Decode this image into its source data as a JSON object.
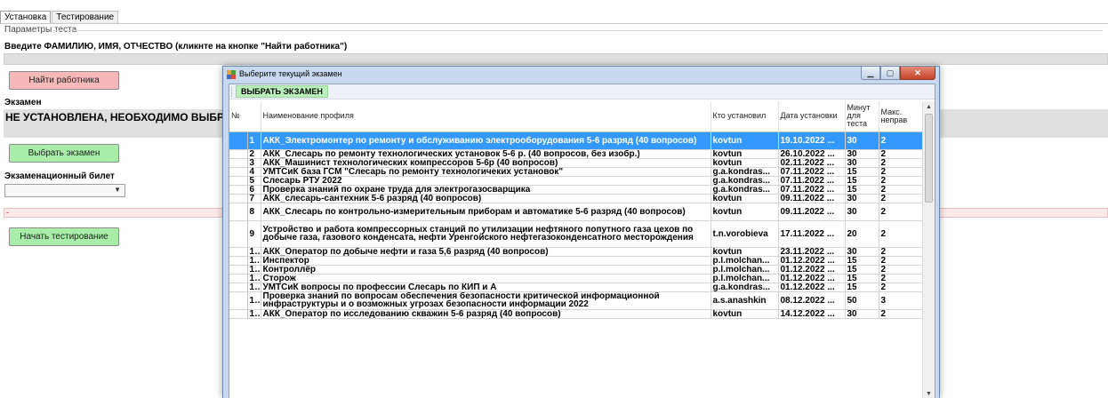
{
  "tabs": [
    {
      "label": "Установка"
    },
    {
      "label": "Тестирование"
    }
  ],
  "params_label": "Параметры теста",
  "prompt": "Введите ФАМИЛИЮ, ИМЯ, ОТЧЕСТВО (кликнте на кнопке \"Найти работника\")",
  "find_button": "Найти работника",
  "exam_label": "Экзамен",
  "exam_status": "НЕ УСТАНОВЛЕНА, НЕОБХОДИМО ВЫБРАТ",
  "choose_exam_button": "Выбрать экзамен",
  "ticket_label": "Экзаменационный билет",
  "ticket_value": "",
  "dash_text": "-",
  "start_button": "Начать тестирование",
  "dialog": {
    "title": "Выберите текущий экзамен",
    "toolbar_button": "ВЫБРАТЬ ЭКЗАМЕН",
    "columns": [
      "№",
      "Наименование профиля",
      "Кто установил",
      "Дата установки",
      "Минут для теста",
      "Макс. неправ"
    ],
    "rows": [
      {
        "n": "1",
        "name": "АКК_Электромонтер по ремонту и обслуживанию электрооборудования 5-6 разряд (40 вопросов)",
        "who": "kovtun",
        "date": "19.10.2022 ...",
        "min": "30",
        "max": "2",
        "selected": true,
        "h": "tall"
      },
      {
        "n": "2",
        "name": "АКК_Слесарь по ремонту технологических установок 5-6 р. (40 вопросов, без изобр.)",
        "who": "kovtun",
        "date": "26.10.2022 ...",
        "min": "30",
        "max": "2"
      },
      {
        "n": "3",
        "name": "АКК_Машинист технологических компрессоров 5-6р (40 вопросов)",
        "who": "kovtun",
        "date": "02.11.2022 ...",
        "min": "30",
        "max": "2"
      },
      {
        "n": "4",
        "name": "УМТСиК база ГСМ \"Слесарь по ремонту технологичеких установок\"",
        "who": "g.a.kondras...",
        "date": "07.11.2022 ...",
        "min": "15",
        "max": "2"
      },
      {
        "n": "5",
        "name": "Слесарь РТУ 2022",
        "who": "g.a.kondras...",
        "date": "07.11.2022 ...",
        "min": "15",
        "max": "2"
      },
      {
        "n": "6",
        "name": "Проверка знаний по охране труда для электрогазосварщика",
        "who": "g.a.kondras...",
        "date": "07.11.2022 ...",
        "min": "15",
        "max": "2"
      },
      {
        "n": "7",
        "name": "АКК_слесарь-сантехник 5-6 разряд (40 вопросов)",
        "who": "kovtun",
        "date": "09.11.2022 ...",
        "min": "30",
        "max": "2"
      },
      {
        "n": "8",
        "name": "АКК_Слесарь по контрольно-измерительным приборам и автоматике 5-6 разряд  (40 вопросов)",
        "who": "kovtun",
        "date": "09.11.2022 ...",
        "min": "30",
        "max": "2",
        "h": "tall"
      },
      {
        "n": "9",
        "name": "Устройство и работа компрессорных станций по утилизации нефтяного попутного газа цехов по добыче газа, газового конденсата, нефти Уренгойского нефтегазоконденсатного месторождения",
        "who": "t.n.vorobieva",
        "date": "17.11.2022 ...",
        "min": "20",
        "max": "2",
        "h": "xtall"
      },
      {
        "n": "10",
        "name": "АКК_Оператор по добыче нефти и газа 5,6 разряд (40 вопросов)",
        "who": "kovtun",
        "date": "23.11.2022 ...",
        "min": "30",
        "max": "2"
      },
      {
        "n": "11",
        "name": "Инспектор",
        "who": "p.l.molchan...",
        "date": "01.12.2022 ...",
        "min": "15",
        "max": "2"
      },
      {
        "n": "12",
        "name": "Контроллёр",
        "who": "p.l.molchan...",
        "date": "01.12.2022 ...",
        "min": "15",
        "max": "2"
      },
      {
        "n": "13",
        "name": "Сторож",
        "who": "p.l.molchan...",
        "date": "01.12.2022 ...",
        "min": "15",
        "max": "2"
      },
      {
        "n": "14",
        "name": "УМТСиК вопросы по профессии Слесарь по КИП и А",
        "who": "g.a.kondras...",
        "date": "01.12.2022 ...",
        "min": "15",
        "max": "2"
      },
      {
        "n": "15",
        "name": "Проверка знаний по вопросам обеспечения безопасности критической информационной инфраструктуры и о возможных угрозах безопасности информации 2022",
        "who": "a.s.anashkin",
        "date": "08.12.2022 ...",
        "min": "50",
        "max": "3",
        "h": "tall"
      },
      {
        "n": "16",
        "name": "АКК_Оператор по исследованию скважин 5-6 разряд (40 вопросов)",
        "who": "kovtun",
        "date": "14.12.2022 ...",
        "min": "30",
        "max": "2"
      }
    ]
  },
  "colors": {
    "selection": "#3399ff",
    "find_button": "#f6b8b8",
    "green_button": "#a8eda8",
    "titlebar": "#c7d9ef",
    "close_button": "#c4432a"
  },
  "icons": {
    "app": "app-icon",
    "minimize": "minimize-icon",
    "maximize": "maximize-icon",
    "close": "close-icon",
    "dropdown": "chevron-down-icon"
  }
}
